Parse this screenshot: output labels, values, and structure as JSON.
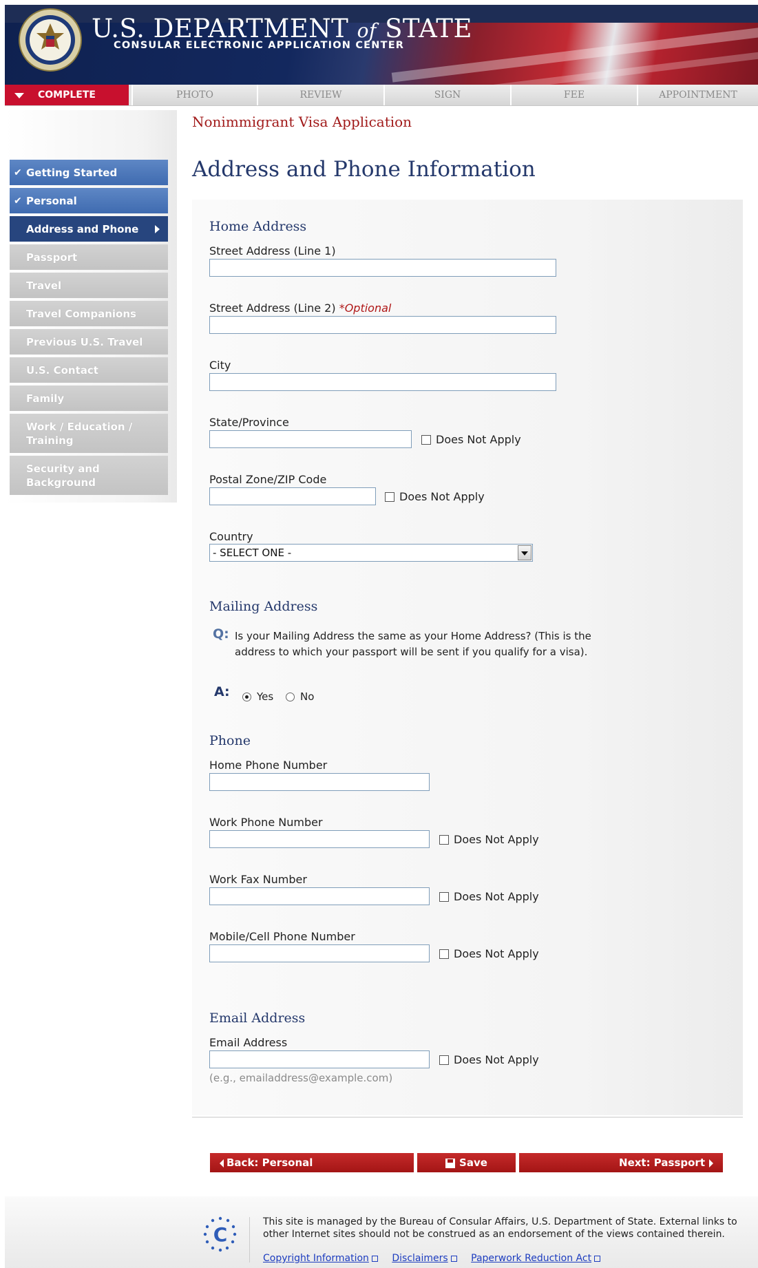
{
  "header": {
    "title_pre": "U.S. DEPARTMENT ",
    "title_of": "of",
    "title_post": " STATE",
    "subtitle": "CONSULAR ELECTRONIC APPLICATION CENTER",
    "seal_icon": "department-of-state-seal"
  },
  "progress_tabs": [
    {
      "label": "COMPLETE",
      "active": true
    },
    {
      "label": "PHOTO",
      "active": false
    },
    {
      "label": "REVIEW",
      "active": false
    },
    {
      "label": "SIGN",
      "active": false
    },
    {
      "label": "FEE",
      "active": false
    },
    {
      "label": "APPOINTMENT",
      "active": false
    }
  ],
  "sidebar": {
    "items": [
      {
        "label": "Getting Started",
        "state": "done"
      },
      {
        "label": "Personal",
        "state": "done"
      },
      {
        "label": "Address and Phone",
        "state": "current"
      },
      {
        "label": "Passport",
        "state": "todo"
      },
      {
        "label": "Travel",
        "state": "todo"
      },
      {
        "label": "Travel Companions",
        "state": "todo"
      },
      {
        "label": "Previous U.S. Travel",
        "state": "todo"
      },
      {
        "label": "U.S. Contact",
        "state": "todo"
      },
      {
        "label": "Family",
        "state": "todo"
      },
      {
        "label": "Work / Education / Training",
        "state": "todo"
      },
      {
        "label": "Security and Background",
        "state": "todo"
      }
    ]
  },
  "main": {
    "app_title": "Nonimmigrant Visa Application",
    "page_title": "Address and Phone Information",
    "home_address": {
      "heading": "Home Address",
      "street1_label": "Street Address (Line 1)",
      "street1_value": "",
      "street2_label": "Street Address (Line 2) ",
      "street2_optional": "*Optional",
      "street2_value": "",
      "city_label": "City",
      "city_value": "",
      "state_label": "State/Province",
      "state_value": "",
      "postal_label": "Postal Zone/ZIP Code",
      "postal_value": "",
      "country_label": "Country",
      "country_selected": "- SELECT ONE -"
    },
    "mailing_address": {
      "heading": "Mailing Address",
      "q_marker": "Q:",
      "question": "Is your Mailing Address the same as your Home Address? (This is the address to which your passport will be sent if you qualify for a visa).",
      "a_marker": "A:",
      "yes_label": "Yes",
      "no_label": "No",
      "selected": "Yes"
    },
    "phone": {
      "heading": "Phone",
      "home_label": "Home Phone Number",
      "home_value": "",
      "work_label": "Work Phone Number",
      "work_value": "",
      "fax_label": "Work Fax Number",
      "fax_value": "",
      "mobile_label": "Mobile/Cell Phone Number",
      "mobile_value": ""
    },
    "email": {
      "heading": "Email Address",
      "label": "Email Address",
      "value": "",
      "hint": "(e.g., emailaddress@example.com)"
    },
    "does_not_apply": "Does Not Apply"
  },
  "buttons": {
    "back": "Back: Personal",
    "save": "Save",
    "next": "Next: Passport"
  },
  "footer": {
    "text": "This site is managed by the Bureau of Consular Affairs, U.S. Department of State. External links to other Internet sites should not be construed as an endorsement of the views contained therein.",
    "links": [
      "Copyright Information",
      "Disclaimers",
      "Paperwork Reduction Act"
    ]
  },
  "colors": {
    "header_blue": "#1e2d55",
    "active_tab_red": "#c8102e",
    "nav_done_blue": "#4a76b9",
    "nav_current_navy": "#27457e",
    "heading_navy": "#24386b",
    "button_red": "#a31515"
  }
}
